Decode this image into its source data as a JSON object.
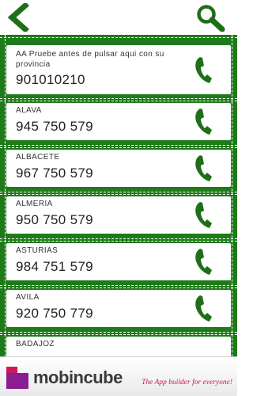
{
  "header": {
    "back_icon": "chevron-left-icon",
    "search_icon": "search-icon"
  },
  "contacts": [
    {
      "name": "AA Pruebe antes de pulsar aqui con su provincia",
      "number": "901010210"
    },
    {
      "name": "ALAVA",
      "number": "945 750 579"
    },
    {
      "name": "ALBACETE",
      "number": "967 750 579"
    },
    {
      "name": "ALMERIA",
      "number": "950 750 579"
    },
    {
      "name": "ASTURIAS",
      "number": "984 751 579"
    },
    {
      "name": "AVILA",
      "number": "920 750 779"
    },
    {
      "name": "BADAJOZ",
      "number": ""
    }
  ],
  "footer": {
    "brand": "mobincube",
    "tagline": "The App builder for everyone!"
  },
  "colors": {
    "green": "#1f7a1a",
    "brand_pink": "#d0165d"
  }
}
